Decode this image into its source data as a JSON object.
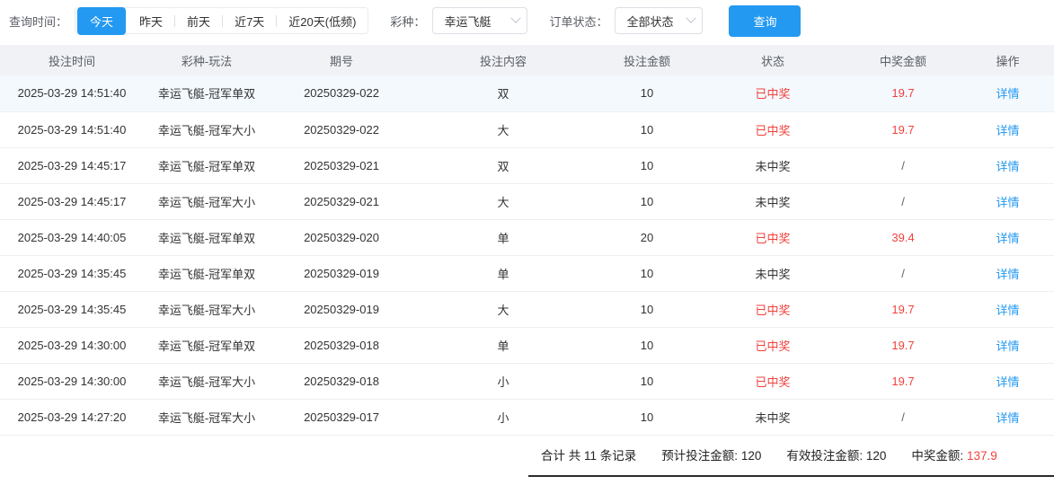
{
  "colors": {
    "accent": "#2399f2",
    "danger": "#f0413c"
  },
  "filters": {
    "time_label": "查询时间：",
    "time_options": [
      {
        "label": "今天",
        "active": true
      },
      {
        "label": "昨天",
        "active": false
      },
      {
        "label": "前天",
        "active": false
      },
      {
        "label": "近7天",
        "active": false
      },
      {
        "label": "近20天(低频)",
        "active": false
      }
    ],
    "lottery_label": "彩种：",
    "lottery_value": "幸运飞艇",
    "status_label": "订单状态：",
    "status_value": "全部状态",
    "search_button": "查询"
  },
  "table": {
    "columns": [
      "投注时间",
      "彩种-玩法",
      "期号",
      "投注内容",
      "投注金额",
      "状态",
      "中奖金额",
      "操作"
    ],
    "action_label": "详情",
    "rows": [
      {
        "time": "2025-03-29 14:51:40",
        "play": "幸运飞艇-冠军单双",
        "issue": "20250329-022",
        "content": "双",
        "amount": "10",
        "status": "已中奖",
        "win": true,
        "prize": "19.7"
      },
      {
        "time": "2025-03-29 14:51:40",
        "play": "幸运飞艇-冠军大小",
        "issue": "20250329-022",
        "content": "大",
        "amount": "10",
        "status": "已中奖",
        "win": true,
        "prize": "19.7"
      },
      {
        "time": "2025-03-29 14:45:17",
        "play": "幸运飞艇-冠军单双",
        "issue": "20250329-021",
        "content": "双",
        "amount": "10",
        "status": "未中奖",
        "win": false,
        "prize": "/"
      },
      {
        "time": "2025-03-29 14:45:17",
        "play": "幸运飞艇-冠军大小",
        "issue": "20250329-021",
        "content": "大",
        "amount": "10",
        "status": "未中奖",
        "win": false,
        "prize": "/"
      },
      {
        "time": "2025-03-29 14:40:05",
        "play": "幸运飞艇-冠军单双",
        "issue": "20250329-020",
        "content": "单",
        "amount": "20",
        "status": "已中奖",
        "win": true,
        "prize": "39.4"
      },
      {
        "time": "2025-03-29 14:35:45",
        "play": "幸运飞艇-冠军单双",
        "issue": "20250329-019",
        "content": "单",
        "amount": "10",
        "status": "未中奖",
        "win": false,
        "prize": "/"
      },
      {
        "time": "2025-03-29 14:35:45",
        "play": "幸运飞艇-冠军大小",
        "issue": "20250329-019",
        "content": "大",
        "amount": "10",
        "status": "已中奖",
        "win": true,
        "prize": "19.7"
      },
      {
        "time": "2025-03-29 14:30:00",
        "play": "幸运飞艇-冠军单双",
        "issue": "20250329-018",
        "content": "单",
        "amount": "10",
        "status": "已中奖",
        "win": true,
        "prize": "19.7"
      },
      {
        "time": "2025-03-29 14:30:00",
        "play": "幸运飞艇-冠军大小",
        "issue": "20250329-018",
        "content": "小",
        "amount": "10",
        "status": "已中奖",
        "win": true,
        "prize": "19.7"
      },
      {
        "time": "2025-03-29 14:27:20",
        "play": "幸运飞艇-冠军大小",
        "issue": "20250329-017",
        "content": "小",
        "amount": "10",
        "status": "未中奖",
        "win": false,
        "prize": "/"
      }
    ]
  },
  "footer": {
    "total_records": "合计 共 11 条记录",
    "expected_label": "预计投注金额:",
    "expected_value": "120",
    "valid_label": "有效投注金额:",
    "valid_value": "120",
    "prize_label": "中奖金额:",
    "prize_value": "137.9"
  }
}
